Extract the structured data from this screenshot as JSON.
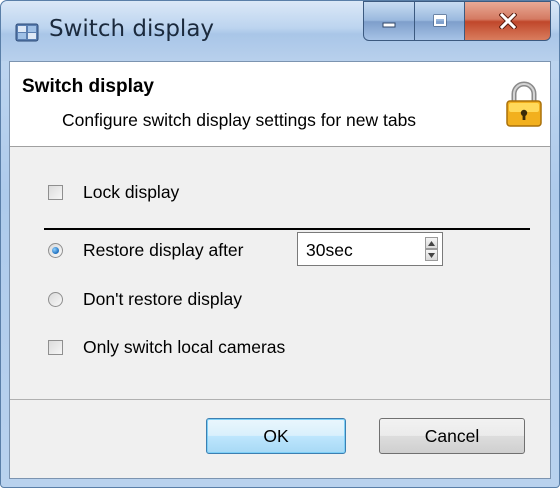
{
  "window": {
    "title": "Switch display",
    "controls": {
      "minimize": "minimize",
      "maximize": "maximize",
      "close": "close"
    }
  },
  "header": {
    "title": "Switch display",
    "subtitle": "Configure switch display settings for new tabs",
    "icon": "padlock-icon"
  },
  "options": {
    "lock_display": {
      "label": "Lock display",
      "checked": false
    },
    "restore_after": {
      "label": "Restore display after",
      "selected": true,
      "value": "30sec"
    },
    "dont_restore": {
      "label": "Don't restore display",
      "selected": false
    },
    "only_local": {
      "label": "Only switch local cameras",
      "checked": false
    }
  },
  "buttons": {
    "ok": "OK",
    "cancel": "Cancel"
  },
  "colors": {
    "titlebar": "#bcd4ef",
    "close_button": "#c0472b",
    "radio_selected": "#1d6fbe",
    "ok_button": "#bee6fd"
  }
}
